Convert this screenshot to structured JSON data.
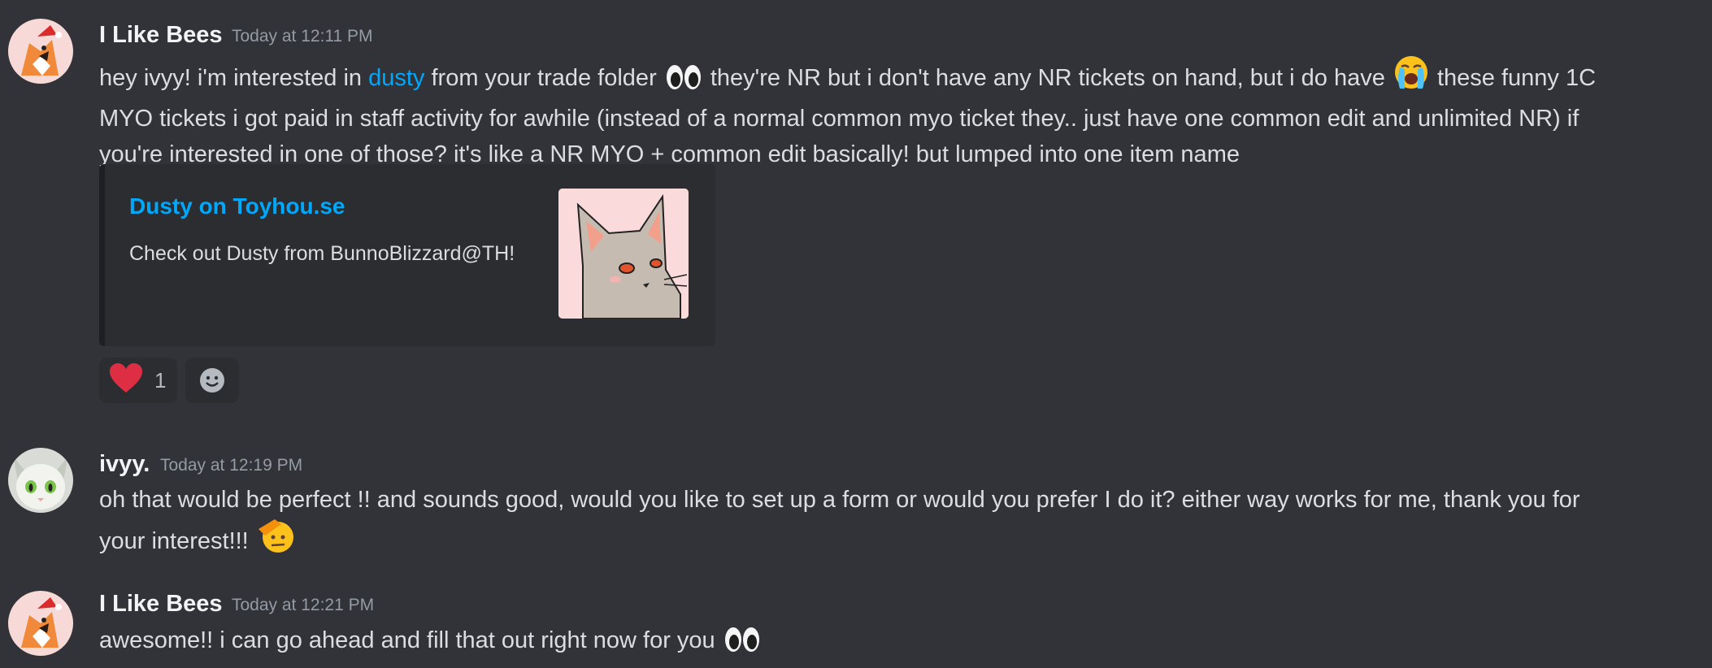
{
  "messages": [
    {
      "author": "I Like Bees",
      "timestamp": "Today at 12:11 PM",
      "line1_a": "hey ivyy! i'm interested in ",
      "link": "dusty",
      "line1_b": " from your trade folder ",
      "line1_c": " they're NR but i don't have any NR tickets on hand, but i do have ",
      "line1_d": " these funny 1C",
      "line2": "MYO tickets i got paid in staff activity for awhile (instead of a normal common myo ticket they.. just have one common edit and unlimited NR) if",
      "line3": "you're interested in one of those? it's like a NR MYO + common edit basically! but lumped into one item name",
      "embed": {
        "title": "Dusty on Toyhou.se",
        "description": "Check out Dusty from BunnoBlizzard@TH!"
      },
      "reactions": [
        {
          "emoji": "red-heart",
          "count": "1"
        }
      ],
      "add_reaction_icon": "add-reaction-smiley-icon"
    },
    {
      "author": "ivyy.",
      "timestamp": "Today at 12:19 PM",
      "line1": "oh that would be perfect !! and sounds good, would you like to set up a form or would you prefer I do it? either way works for me, thank you for",
      "line2": "your interest!!! "
    },
    {
      "author": "I Like Bees",
      "timestamp": "Today at 12:21 PM",
      "line1": "awesome!! i can go ahead and fill that out right now for you "
    }
  ],
  "colors": {
    "background": "#313338",
    "link": "#00a8fc",
    "text": "#dbdee1",
    "author": "#f2f3f5",
    "timestamp": "#949ba4",
    "embed_bg": "#2b2d31"
  }
}
